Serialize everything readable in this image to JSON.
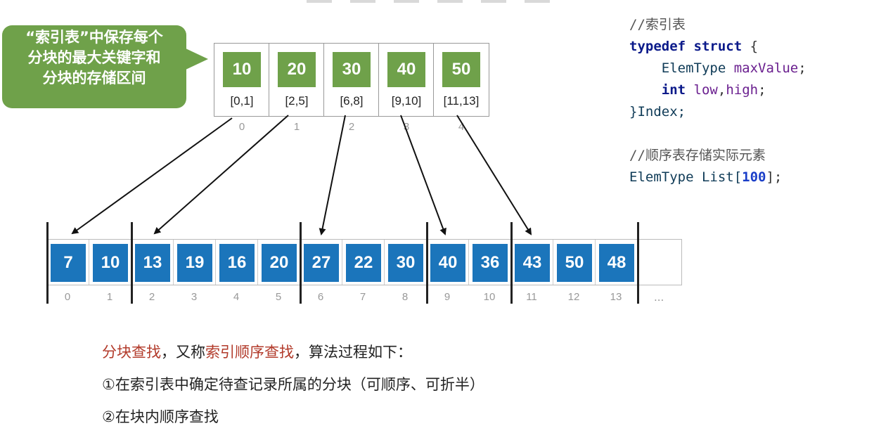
{
  "callout": {
    "lines": [
      "“索引表”中保存每个",
      "分块的最大关键字和",
      "分块的存储区间"
    ]
  },
  "index_table": {
    "entries": [
      {
        "max": "10",
        "range": "[0,1]"
      },
      {
        "max": "20",
        "range": "[2,5]"
      },
      {
        "max": "30",
        "range": "[6,8]"
      },
      {
        "max": "40",
        "range": "[9,10]"
      },
      {
        "max": "50",
        "range": "[11,13]"
      }
    ],
    "indices": [
      "0",
      "1",
      "2",
      "3",
      "4"
    ]
  },
  "list": {
    "values": [
      "7",
      "10",
      "13",
      "19",
      "16",
      "20",
      "27",
      "22",
      "30",
      "40",
      "36",
      "43",
      "50",
      "48"
    ],
    "indices": [
      "0",
      "1",
      "2",
      "3",
      "4",
      "5",
      "6",
      "7",
      "8",
      "9",
      "10",
      "11",
      "12",
      "13"
    ],
    "ellipsis": "..."
  },
  "code": {
    "comment1": "//索引表",
    "typedef_kw": "typedef",
    "struct_kw": "struct",
    "open_brace": " {",
    "elemtype1": "ElemType",
    "maxvalue": " maxValue",
    "semi1": ";",
    "int_kw": "int",
    "low": " low",
    "comma": ",",
    "high": "high",
    "semi2": ";",
    "close_index": "}Index;",
    "comment2": "//顺序表存储实际元素",
    "elemtype2": "ElemType",
    "list_decl": " List[",
    "hundred": "100",
    "list_end": "];"
  },
  "explain": {
    "part_a": "分块查找",
    "part_b": "，又称",
    "part_c": "索引顺序查找",
    "part_d": "，算法过程如下：",
    "step1": "①在索引表中确定待查记录所属的分块（可顺序、可折半）",
    "step2": "②在块内顺序查找"
  },
  "colors": {
    "green": "#6fa14a",
    "blue": "#1b75bb",
    "red_text": "#b23a2a"
  }
}
